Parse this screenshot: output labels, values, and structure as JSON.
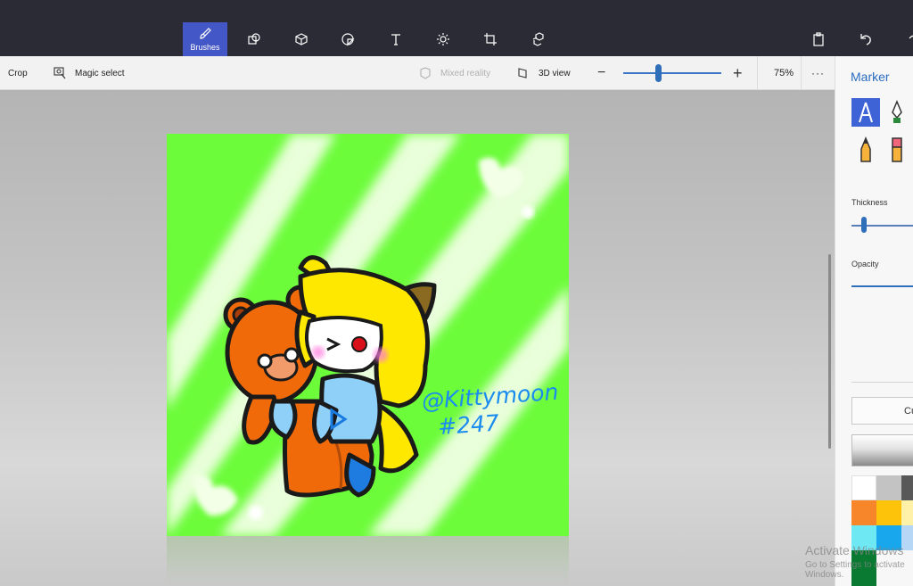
{
  "toolbar": {
    "tools": [
      {
        "name": "Brushes",
        "icon": "brush-icon",
        "active": true
      },
      {
        "name": "2d-shapes",
        "icon": "2d-shapes-icon"
      },
      {
        "name": "3d-shapes",
        "icon": "3d-shapes-icon"
      },
      {
        "name": "stickers",
        "icon": "stickers-icon"
      },
      {
        "name": "text",
        "icon": "text-icon"
      },
      {
        "name": "effects",
        "icon": "effects-icon"
      },
      {
        "name": "canvas",
        "icon": "canvas-icon"
      },
      {
        "name": "3d-library",
        "icon": "3d-library-icon"
      }
    ],
    "brushes_label": "Brushes"
  },
  "subtoolbar": {
    "crop_label": "Crop",
    "magic_select_label": "Magic select",
    "mixed_reality_label": "Mixed reality",
    "view_3d_label": "3D view",
    "zoom_value": "75%",
    "zoom_level": 0.37,
    "more_label": "···"
  },
  "panel": {
    "title": "Marker",
    "brushes": [
      "marker-icon",
      "calligraphy-pen-icon",
      "pencil-icon",
      "eraser-icon"
    ],
    "thickness_label": "Thickness",
    "opacity_label": "Opacity",
    "custom_label": "Cu",
    "swatches": [
      "#ffffff",
      "#c3c3c3",
      "#585858",
      "#f7862a",
      "#fdc30a",
      "#fff2a8",
      "#6ee9f4",
      "#18a7ec",
      "#b6d7f5",
      "#0a7a32"
    ]
  },
  "canvas": {
    "signature_line1": "@Kittymoon",
    "signature_line2": "#247"
  },
  "watermark": {
    "title": "Activate Windows",
    "subtitle": "Go to Settings to activate Windows."
  },
  "colors": {
    "accent": "#4457c6",
    "toolbar_bg": "#2b2b35",
    "canvas_green": "#6cfc3a"
  }
}
